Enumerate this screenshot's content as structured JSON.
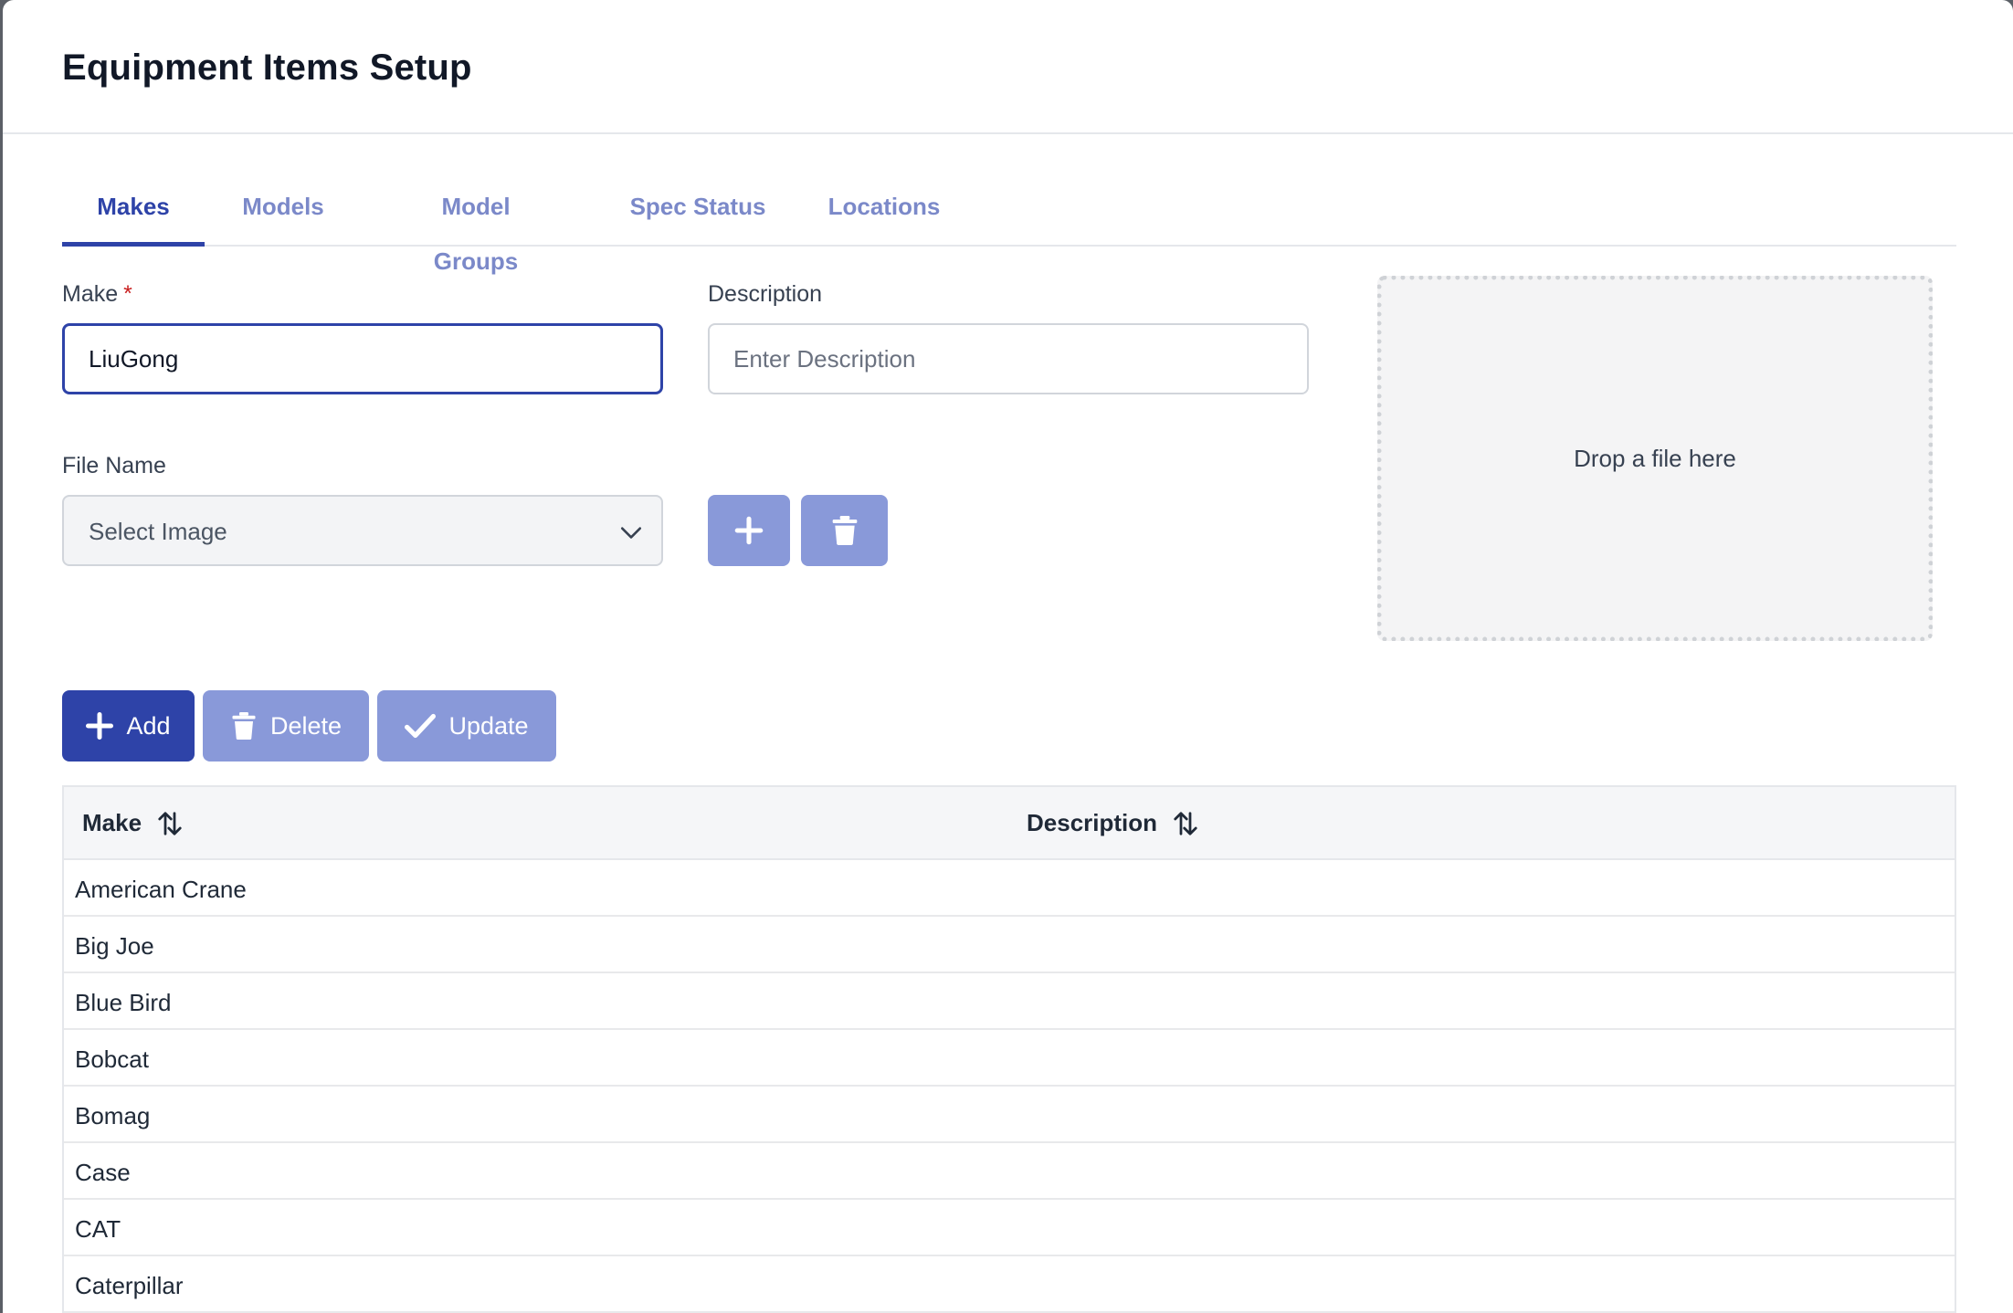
{
  "dialog": {
    "title": "Equipment Items Setup"
  },
  "tabs": [
    {
      "label": "Makes",
      "active": true
    },
    {
      "label": "Models",
      "active": false
    },
    {
      "label": "Model Groups",
      "active": false
    },
    {
      "label": "Spec Status",
      "active": false
    },
    {
      "label": "Locations",
      "active": false
    }
  ],
  "form": {
    "make_label": "Make",
    "required_mark": "*",
    "make_value": "LiuGong",
    "description_label": "Description",
    "description_placeholder": "Enter Description",
    "file_name_label": "File Name",
    "file_select_value": "Select Image",
    "dropzone_text": "Drop a file here"
  },
  "actions": {
    "add_label": "Add",
    "delete_label": "Delete",
    "update_label": "Update"
  },
  "table": {
    "columns": [
      "Make",
      "Description"
    ],
    "rows": [
      {
        "make": "American Crane",
        "description": ""
      },
      {
        "make": "Big Joe",
        "description": ""
      },
      {
        "make": "Blue Bird",
        "description": ""
      },
      {
        "make": "Bobcat",
        "description": ""
      },
      {
        "make": "Bomag",
        "description": ""
      },
      {
        "make": "Case",
        "description": ""
      },
      {
        "make": "CAT",
        "description": ""
      },
      {
        "make": "Caterpillar",
        "description": ""
      }
    ]
  },
  "colors": {
    "primary": "#2e43a8",
    "primary_disabled": "#8999d9",
    "tab_inactive": "#7b89c9",
    "required": "#c81e1e"
  },
  "icons": {
    "select_caret": "chevron-down-icon",
    "add_image": "plus-icon",
    "delete_image": "trash-icon",
    "add": "plus-icon",
    "delete": "trash-icon",
    "update": "check-icon",
    "sort": "sort-icon"
  }
}
